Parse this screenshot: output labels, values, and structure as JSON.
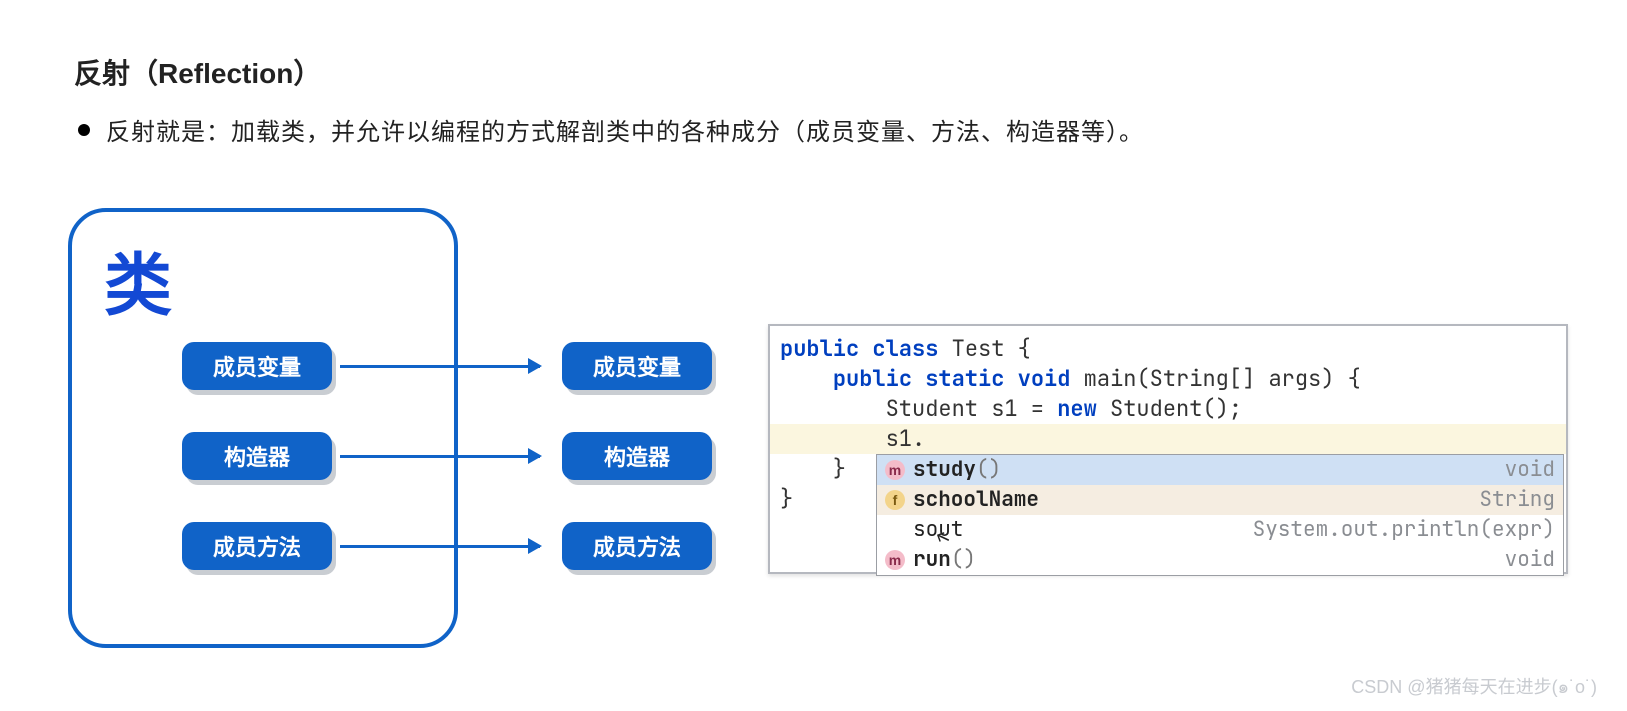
{
  "title": "反射（Reflection）",
  "bullet": "反射就是：加载类，并允许以编程的方式解剖类中的各种成分（成员变量、方法、构造器等）。",
  "class_box": {
    "label": "类",
    "left_items": [
      "成员变量",
      "构造器",
      "成员方法"
    ],
    "right_items": [
      "成员变量",
      "构造器",
      "成员方法"
    ]
  },
  "code": {
    "l1_a": "public",
    "l1_b": "class",
    "l1_c": " Test {",
    "l2_a": "public",
    "l2_b": "static",
    "l2_c": "void",
    "l2_d": " main(String[] args) {",
    "l3_a": "        Student s1 = ",
    "l3_b": "new",
    "l3_c": " Student();",
    "l4": "        s1.",
    "l5": "    }",
    "l6": "}"
  },
  "popup": [
    {
      "icon": "m",
      "name": "study",
      "suffix": "()",
      "type": "void"
    },
    {
      "icon": "f",
      "name": "schoolName",
      "suffix": "",
      "type": "String"
    },
    {
      "icon": "",
      "name": "sout",
      "suffix": "",
      "type": "System.out.println(expr)"
    },
    {
      "icon": "m",
      "name": "run",
      "suffix": "()",
      "type": "void"
    }
  ],
  "watermark": "CSDN @猪猪每天在进步(๑˙o˙)"
}
